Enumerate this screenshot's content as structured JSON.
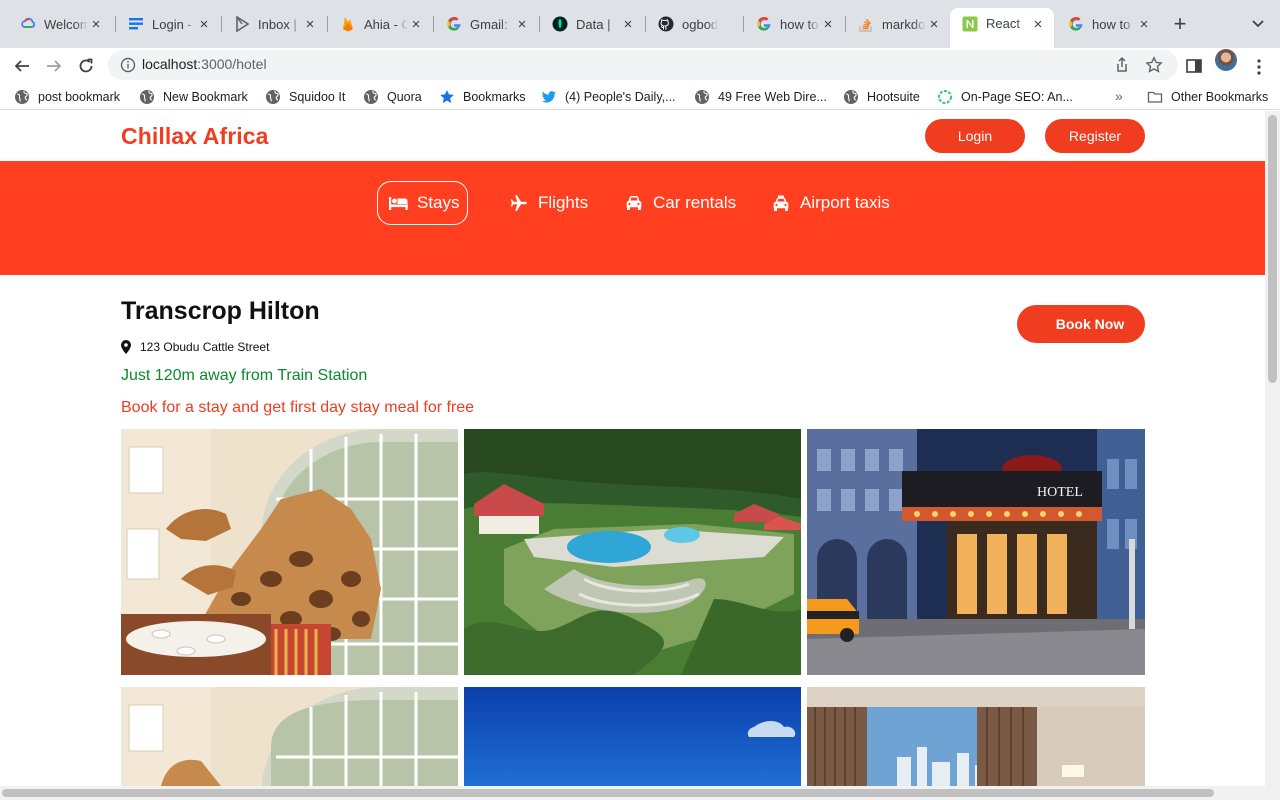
{
  "browser": {
    "tabs": [
      {
        "title": "Welcome",
        "icon": "google-cloud-icon"
      },
      {
        "title": "Login - ",
        "icon": "doc-icon"
      },
      {
        "title": "Inbox | ",
        "icon": "inbox-icon"
      },
      {
        "title": "Ahia - C",
        "icon": "firebase-icon"
      },
      {
        "title": "Gmail: ",
        "icon": "google-icon"
      },
      {
        "title": "Data | ",
        "icon": "mongodb-icon"
      },
      {
        "title": "ogbodo",
        "icon": "github-icon"
      },
      {
        "title": "how to",
        "icon": "google-icon"
      },
      {
        "title": "markdo",
        "icon": "stackoverflow-icon"
      },
      {
        "title": "React",
        "icon": "nodejs-icon"
      },
      {
        "title": "how to",
        "icon": "google-icon"
      }
    ],
    "active_tab_index": 9,
    "url_host": "localhost",
    "url_path": ":3000/hotel",
    "bookmarks": [
      {
        "label": "post bookmark",
        "icon": "globe-icon"
      },
      {
        "label": "New Bookmark",
        "icon": "globe-icon"
      },
      {
        "label": "Squidoo It",
        "icon": "globe-icon"
      },
      {
        "label": "Quora",
        "icon": "globe-icon"
      },
      {
        "label": "Bookmarks",
        "icon": "star-icon"
      },
      {
        "label": "(4) People's Daily,...",
        "icon": "twitter-icon"
      },
      {
        "label": "49 Free Web Dire...",
        "icon": "globe-icon"
      },
      {
        "label": "Hootsuite",
        "icon": "globe-icon"
      },
      {
        "label": "On-Page SEO: An...",
        "icon": "circle-icon"
      }
    ],
    "other_bookmarks": "Other Bookmarks",
    "overflow": "»"
  },
  "site": {
    "brand": "Chillax Africa",
    "login": "Login",
    "register": "Register",
    "colors": {
      "accent": "#f03c1f",
      "hero": "#ff3f1f",
      "green": "#0a8a2e"
    },
    "nav": [
      {
        "label": "Stays",
        "icon": "bed-icon",
        "active": true
      },
      {
        "label": "Flights",
        "icon": "plane-icon",
        "active": false
      },
      {
        "label": "Car rentals",
        "icon": "car-icon",
        "active": false
      },
      {
        "label": "Airport taxis",
        "icon": "taxi-icon",
        "active": false
      }
    ]
  },
  "hotel": {
    "name": "Transcrop Hilton",
    "address": "123 Obudu Cattle Street",
    "distance": "Just 120m away from Train Station",
    "offer": "Book for a stay and get first day stay meal for free",
    "book_now": "Book Now",
    "photo_sign": "HOTEL",
    "photos": [
      {
        "subject": "giraffes-dining-room"
      },
      {
        "subject": "resort-pool-hills"
      },
      {
        "subject": "hotel-entrance-city"
      },
      {
        "subject": "giraffes-dining-room"
      },
      {
        "subject": "blue-sky"
      },
      {
        "subject": "hotel-room-window"
      }
    ]
  }
}
